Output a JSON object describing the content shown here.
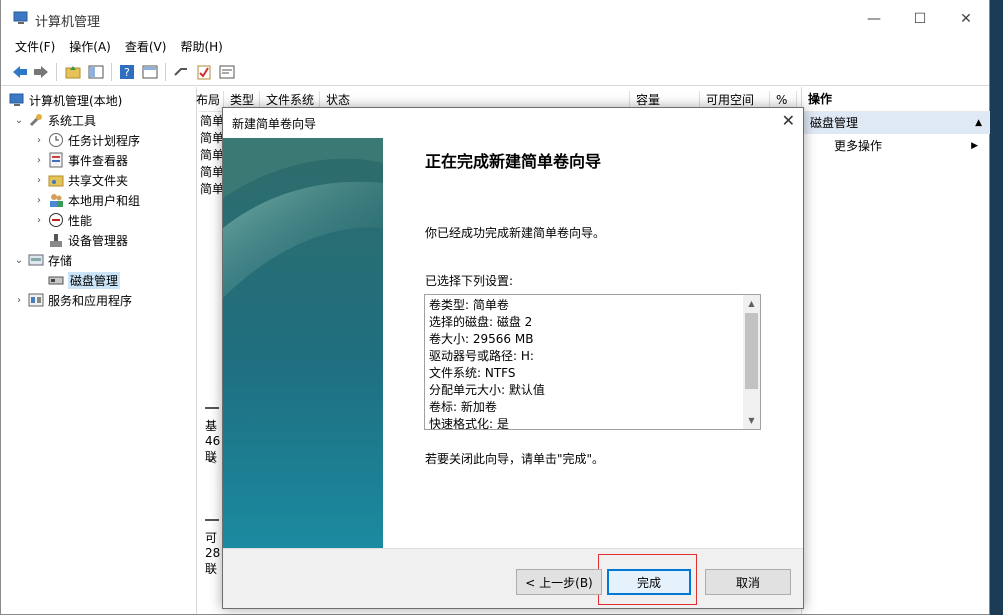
{
  "window": {
    "title": "计算机管理",
    "controls": {
      "minimize": "—",
      "maximize": "☐",
      "close": "✕"
    }
  },
  "menu": [
    "文件(F)",
    "操作(A)",
    "查看(V)",
    "帮助(H)"
  ],
  "tree": {
    "root": "计算机管理(本地)",
    "system_tools": "系统工具",
    "task_scheduler": "任务计划程序",
    "event_viewer": "事件查看器",
    "shared_folders": "共享文件夹",
    "local_users": "本地用户和组",
    "performance": "性能",
    "device_manager": "设备管理器",
    "storage": "存储",
    "disk_management": "磁盘管理",
    "services_apps": "服务和应用程序"
  },
  "list": {
    "columns": {
      "layout": "布局",
      "type": "类型",
      "fs": "文件系统",
      "status": "状态",
      "capacity": "容量",
      "free": "可用空间",
      "pct": "%"
    },
    "rows": [
      "简单",
      "简单",
      "简单",
      "简单",
      "简单"
    ],
    "disk0": {
      "line1": "基",
      "line2": "46",
      "line3": "联"
    },
    "disk1": {
      "line1": "可",
      "line2": "28",
      "line3": "联"
    },
    "scroll_left": "<"
  },
  "actions": {
    "title": "操作",
    "section": "磁盘管理",
    "more": "更多操作",
    "up_arrow": "▲",
    "right_arrow": "▶"
  },
  "wizard": {
    "title": "新建简单卷向导",
    "close": "✕",
    "heading": "正在完成新建简单卷向导",
    "message": "你已经成功完成新建简单卷向导。",
    "settings_label": "已选择下列设置:",
    "settings": [
      "卷类型: 简单卷",
      "选择的磁盘: 磁盘 2",
      "卷大小: 29566 MB",
      "驱动器号或路径: H:",
      "文件系统: NTFS",
      "分配单元大小: 默认值",
      "卷标: 新加卷",
      "快速格式化: 是"
    ],
    "finish_message": "若要关闭此向导，请单击\"完成\"。",
    "back_button": "< 上一步(B)",
    "finish_button": "完成",
    "cancel_button": "取消",
    "highlight_color": "#e03030"
  }
}
